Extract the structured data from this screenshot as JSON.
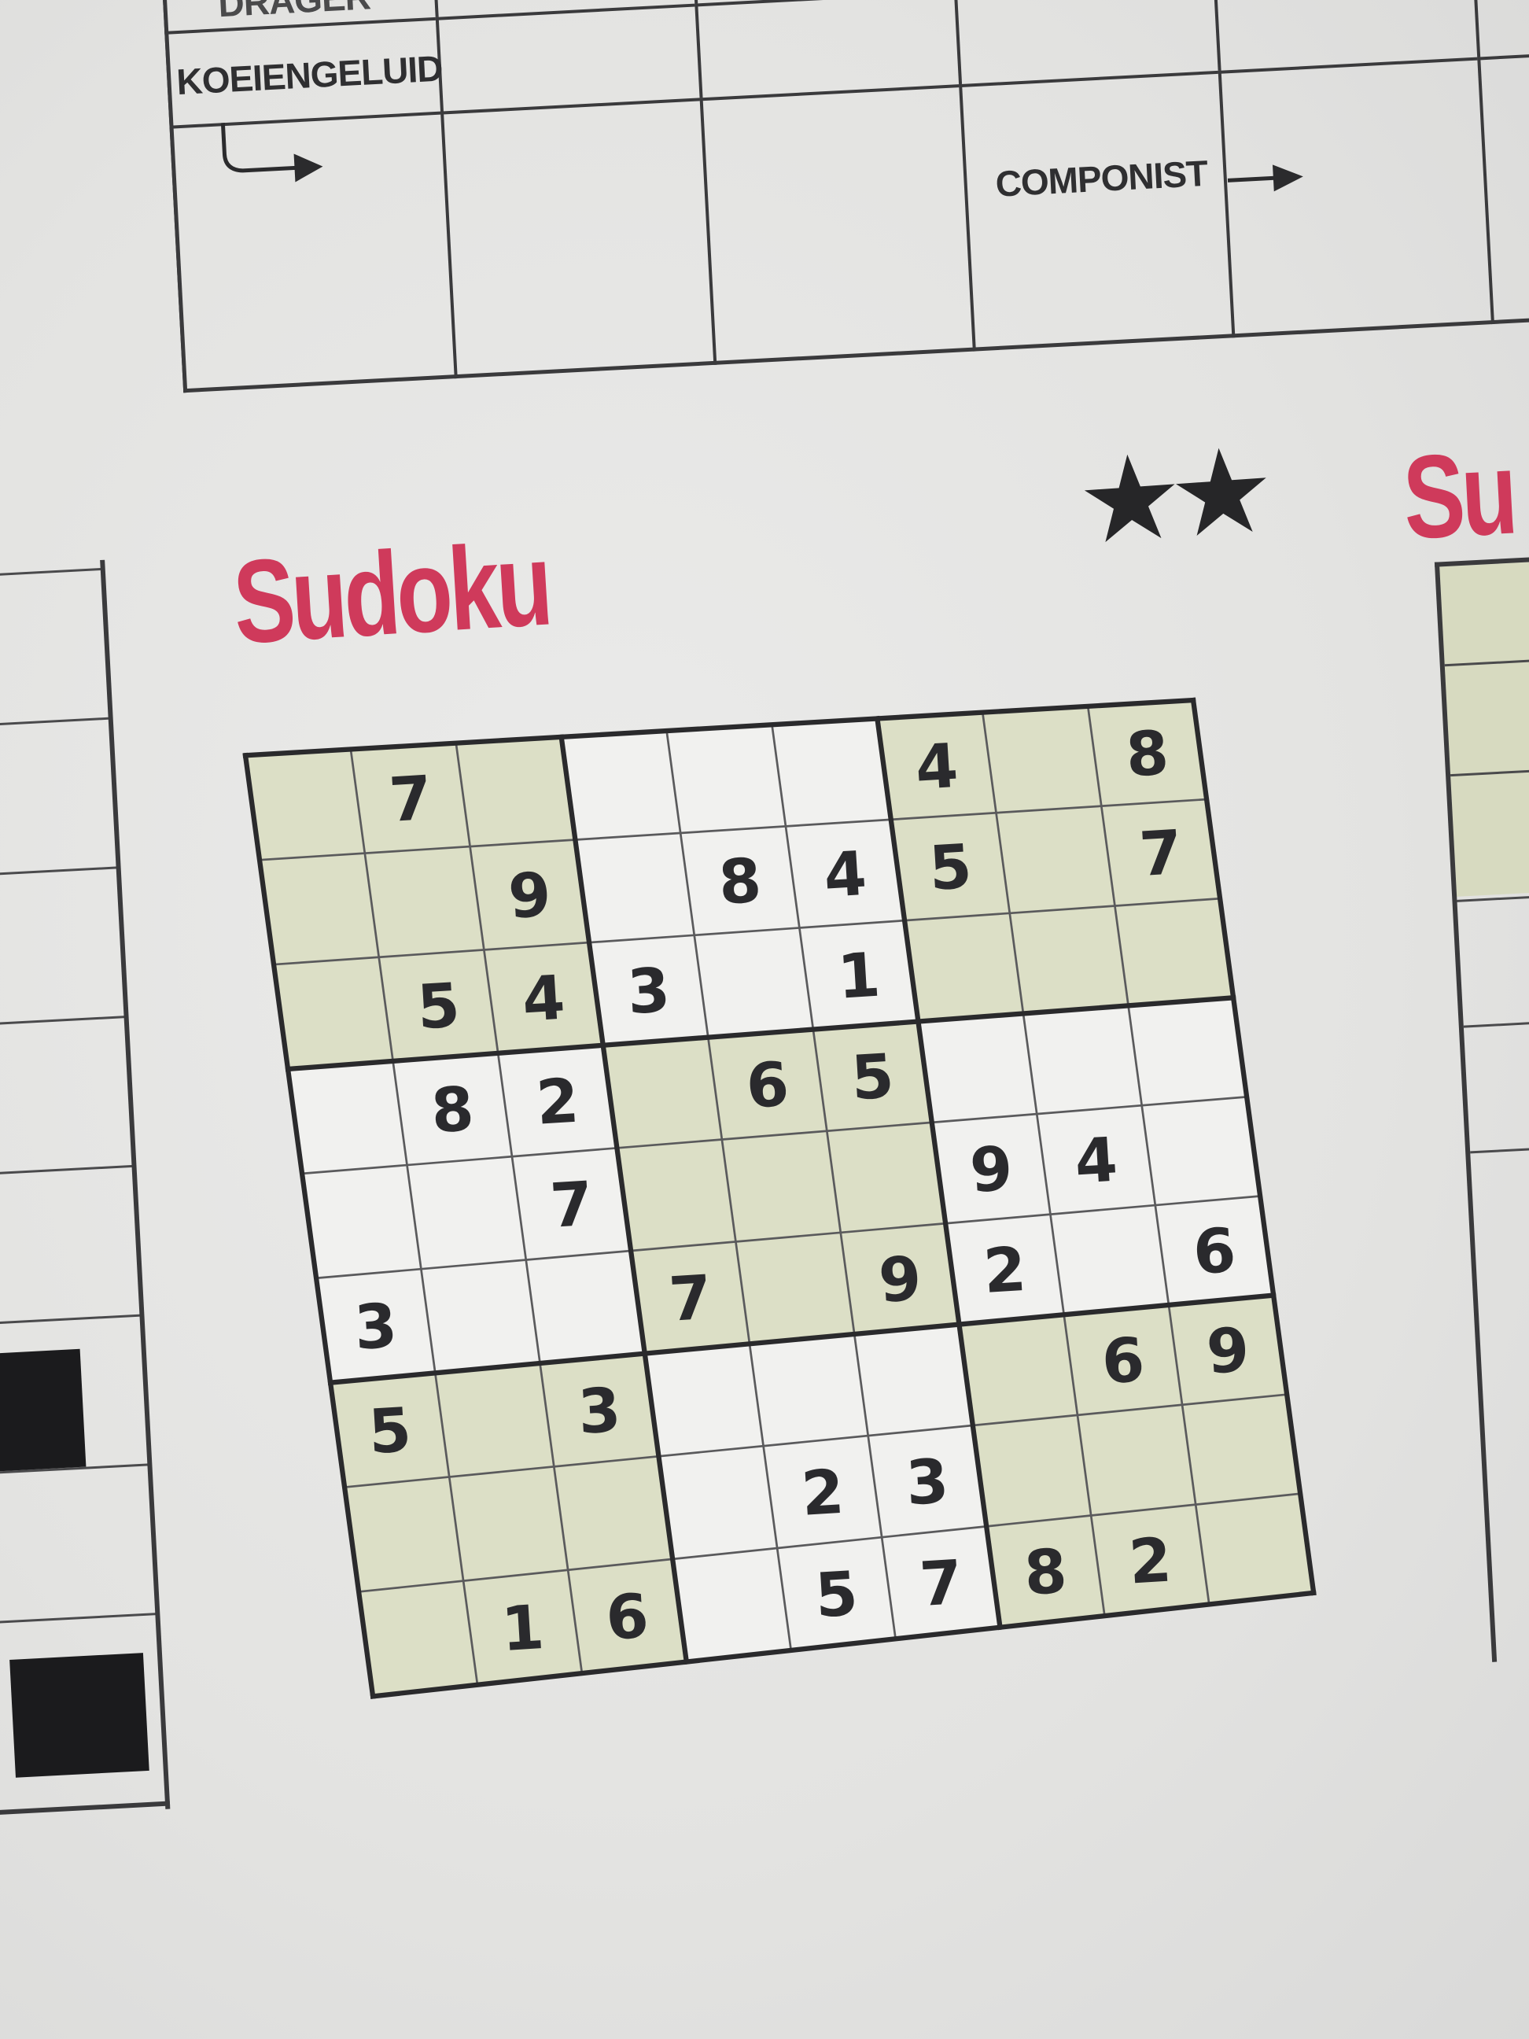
{
  "crossword": {
    "clues": {
      "cut_off_top": "DRAGER",
      "animal_sound": "KOEIENGELUID",
      "composer": "COMPONIST"
    }
  },
  "sudoku": {
    "title": "Sudoku",
    "difficulty_stars": 2,
    "star_glyph": "★",
    "shade_color": "#dcdfc6",
    "title_color": "#cf3a5b",
    "grid": [
      [
        "",
        "7",
        "",
        "",
        "",
        "",
        "4",
        "",
        "8"
      ],
      [
        "",
        "",
        "9",
        "",
        "8",
        "4",
        "5",
        "",
        "7"
      ],
      [
        "",
        "5",
        "4",
        "3",
        "",
        "1",
        "",
        "",
        ""
      ],
      [
        "",
        "8",
        "2",
        "",
        "6",
        "5",
        "",
        "",
        ""
      ],
      [
        "",
        "",
        "7",
        "",
        "",
        "",
        "9",
        "4",
        ""
      ],
      [
        "3",
        "",
        "",
        "7",
        "",
        "9",
        "2",
        "",
        "6"
      ],
      [
        "5",
        "",
        "3",
        "",
        "",
        "",
        "",
        "6",
        "9"
      ],
      [
        "",
        "",
        "",
        "",
        "2",
        "3",
        "",
        "",
        ""
      ],
      [
        "",
        "1",
        "6",
        "",
        "5",
        "7",
        "8",
        "2",
        ""
      ]
    ]
  },
  "right_puzzle": {
    "title": "Su"
  }
}
